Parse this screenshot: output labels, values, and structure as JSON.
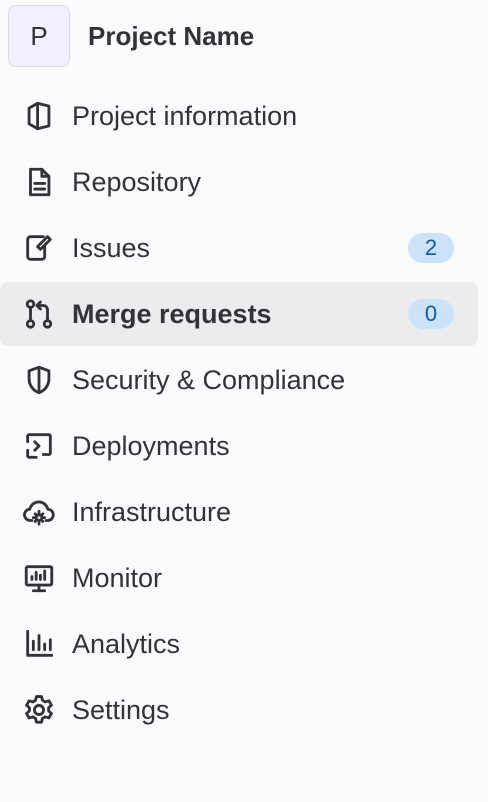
{
  "project": {
    "avatar_letter": "P",
    "name": "Project Name"
  },
  "nav": {
    "items": [
      {
        "label": "Project information",
        "icon": "project-icon"
      },
      {
        "label": "Repository",
        "icon": "document-icon"
      },
      {
        "label": "Issues",
        "icon": "issues-icon",
        "badge": "2"
      },
      {
        "label": "Merge requests",
        "icon": "merge-request-icon",
        "badge": "0",
        "active": true
      },
      {
        "label": "Security & Compliance",
        "icon": "shield-icon"
      },
      {
        "label": "Deployments",
        "icon": "deployments-icon"
      },
      {
        "label": "Infrastructure",
        "icon": "cloud-gear-icon"
      },
      {
        "label": "Monitor",
        "icon": "monitor-icon"
      },
      {
        "label": "Analytics",
        "icon": "chart-icon"
      },
      {
        "label": "Settings",
        "icon": "settings-icon"
      }
    ]
  },
  "colors": {
    "background": "#fbfafd",
    "active_background": "#ececef",
    "text": "#333238",
    "badge_background": "#cbe2f9",
    "badge_text": "#0b5cad"
  }
}
